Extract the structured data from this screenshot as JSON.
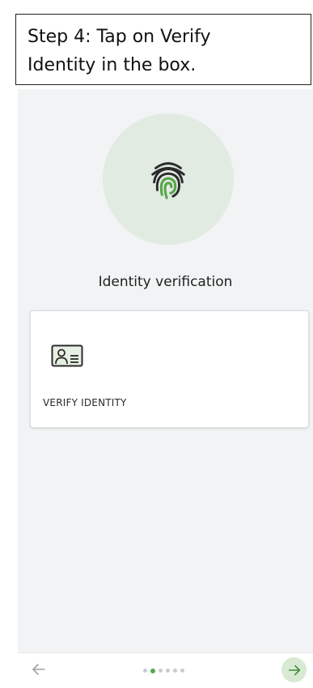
{
  "instruction": {
    "line1": "Step 4: Tap on Verify",
    "line2": "Identity in the box."
  },
  "main": {
    "title": "Identity verification",
    "card": {
      "label": "VERIFY IDENTITY",
      "icon": "id-card-icon"
    },
    "hero_icon": "fingerprint-icon"
  },
  "navigation": {
    "back_icon": "arrow-left-icon",
    "next_icon": "arrow-right-icon",
    "page_count": 6,
    "active_page": 2
  },
  "colors": {
    "accent": "#57a64a",
    "hero_bg": "#e1ebe2",
    "next_bg": "#d8ead3",
    "screen_bg": "#f1f3f4"
  }
}
